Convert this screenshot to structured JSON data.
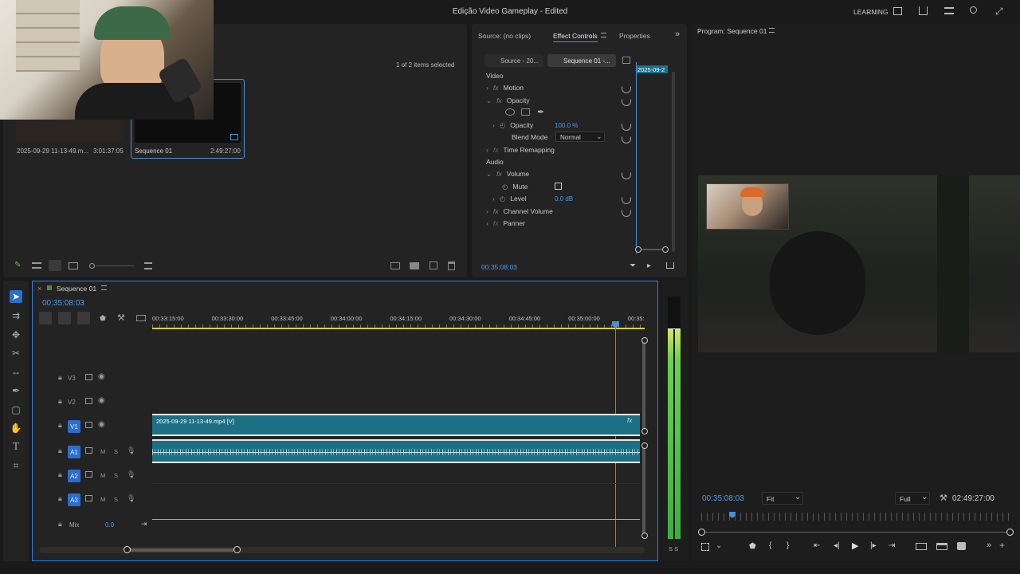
{
  "window": {
    "title": "Edição Video Gameplay - Edited",
    "workspace": "LEARNING"
  },
  "project": {
    "items_status": "1 of 2 items selected",
    "items": [
      {
        "name": "2025-09-29 11-13-49.m...",
        "duration": "3:01:37:05"
      },
      {
        "name": "Sequence 01",
        "duration": "2:49:27:00"
      }
    ]
  },
  "effects_panel": {
    "tabs": [
      "Source: (no clips)",
      "Effect Controls",
      "Properties"
    ],
    "subtabs": [
      "Source - 20...",
      "Sequence 01 -..."
    ],
    "mini_clip_label": "2025-09-2",
    "sections": {
      "video": "Video",
      "audio": "Audio"
    },
    "rows": {
      "motion": "Motion",
      "opacity": "Opacity",
      "opacity_param": "Opacity",
      "opacity_value": "100.0 %",
      "blend_mode": "Blend Mode",
      "blend_value": "Normal",
      "time_remapping": "Time Remapping",
      "volume": "Volume",
      "mute": "Mute",
      "level": "Level",
      "level_value": "0.0 dB",
      "channel_volume": "Channel Volume",
      "panner": "Panner"
    },
    "timecode": "00:35:08:03"
  },
  "program": {
    "title": "Program: Sequence 01",
    "timecode": "00:35:08:03",
    "fit": "Fit",
    "quality": "Full",
    "duration": "02:49:27:00",
    "playhead_progress": 0.1
  },
  "timeline": {
    "sequence_tab": "Sequence 01",
    "timecode": "00:35:08:03",
    "ruler": [
      "00:33:15:00",
      "00:33:30:00",
      "00:33:45:00",
      "00:34:00:00",
      "00:34:15:00",
      "00:34:30:00",
      "00:34:45:00",
      "00:35:00:00",
      "00:35:"
    ],
    "video_tracks": [
      "V3",
      "V2",
      "V1"
    ],
    "audio_tracks": [
      "A1",
      "A2",
      "A3"
    ],
    "mix_label": "Mix",
    "mix_value": "0.0",
    "clip_label": "2025-09-29 11-13-49.mp4 [V]",
    "m": "M",
    "s": "S",
    "fx": "fx"
  },
  "meter": {
    "label": "S S"
  },
  "colors": {
    "accent": "#2a6fd0",
    "clip": "#1d6f84",
    "timecode": "#4a9de8",
    "playhead": "#4a90d9"
  }
}
